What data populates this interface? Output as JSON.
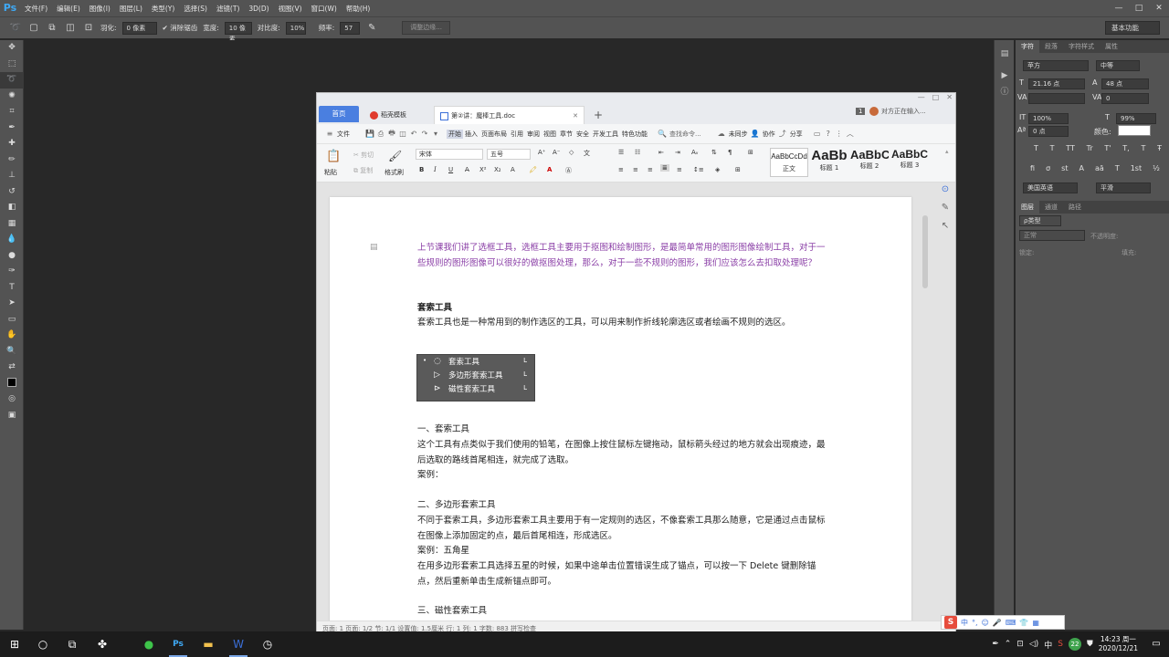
{
  "ps": {
    "logo": "Ps",
    "menu": [
      "文件(F)",
      "编辑(E)",
      "图像(I)",
      "图层(L)",
      "类型(Y)",
      "选择(S)",
      "滤镜(T)",
      "3D(D)",
      "视图(V)",
      "窗口(W)",
      "帮助(H)"
    ],
    "window_controls": [
      "—",
      "□",
      "✕"
    ],
    "options": {
      "feather_label": "羽化:",
      "feather_value": "0 像素",
      "antialias_label": "消除锯齿",
      "width_label": "宽度:",
      "width_value": "10 像素",
      "contrast_label": "对比度:",
      "contrast_value": "10%",
      "frequency_label": "频率:",
      "frequency_value": "57",
      "refine_edge": "调整边缘...",
      "workspace": "基本功能"
    },
    "panels": {
      "char_tabs": [
        "字符",
        "段落",
        "字符样式",
        "属性"
      ],
      "font_family": "苹方",
      "font_style": "中等",
      "font_size": "21.16 点",
      "leading": "48 点",
      "tracking": "0",
      "vscale": "100%",
      "hscale": "99%",
      "baseline": "0 点",
      "color_label": "颜色:",
      "type_buttons": [
        "T",
        "T",
        "TT",
        "Tr",
        "T'",
        "T,",
        "T",
        "Ŧ"
      ],
      "ot_buttons": [
        "fi",
        "σ",
        "st",
        "A",
        "aā",
        "T",
        "1st",
        "½"
      ],
      "language": "美国英语",
      "aa": "平滑",
      "layer_tabs": [
        "图层",
        "通道",
        "路径"
      ],
      "kind_label": "ρ类型",
      "blend_mode": "正常",
      "opacity_label": "不透明度:",
      "lock_label": "锁定:",
      "fill_label": "填充:"
    }
  },
  "wps": {
    "home_tab": "首页",
    "template_tab": "稻壳模板",
    "doc_tab": "第②讲：魔棒工具.doc",
    "add_tab": "+",
    "user_badge": "1",
    "user_status": "对方正在输入...",
    "menu": {
      "file": "文件",
      "items": [
        "开始",
        "插入",
        "页面布局",
        "引用",
        "审阅",
        "视图",
        "章节",
        "安全",
        "开发工具",
        "特色功能"
      ],
      "search": "查找命令...",
      "sync": "未同步",
      "collab": "协作",
      "share": "分享"
    },
    "ribbon": {
      "paste": "粘贴",
      "cut": "剪切",
      "copy": "复制",
      "format_painter": "格式刷",
      "font": "宋体",
      "size": "五号",
      "styles": [
        {
          "preview": "AaBbCcDd",
          "label": "正文"
        },
        {
          "preview": "AaBb",
          "label": "标题 1"
        },
        {
          "preview": "AaBbC",
          "label": "标题 2"
        },
        {
          "preview": "AaBbC",
          "label": "标题 3"
        }
      ]
    },
    "doc": {
      "intro": "上节课我们讲了选框工具，选框工具主要用于抠图和绘制图形，是最简单常用的图形图像绘制工具，对于一些规则的图形图像可以很好的做抠图处理，那么，对于一些不规则的图形，我们应该怎么去扣取处理呢？",
      "h1": "套索工具",
      "p1": "套索工具也是一种常用到的制作选区的工具，可以用来制作折线轮廓选区或者绘画不规则的选区。",
      "lasso_menu": [
        {
          "label": "套索工具",
          "key": "L"
        },
        {
          "label": "多边形套索工具",
          "key": "L"
        },
        {
          "label": "磁性套索工具",
          "key": "L"
        }
      ],
      "s1_title": "一、套索工具",
      "s1_body": "这个工具有点类似于我们使用的铅笔，在图像上按住鼠标左键拖动，鼠标箭头经过的地方就会出现痕迹，最后选取的路线首尾相连，就完成了选取。",
      "s1_example": "案例：",
      "s2_title": "二、多边形套索工具",
      "s2_body": "不同于套索工具，多边形套索工具主要用于有一定规则的选区，不像套索工具那么随意，它是通过点击鼠标在图像上添加固定的点，最后首尾相连，形成选区。",
      "s2_example": "案例：五角星",
      "s2_note": "在用多边形套索工具选择五星的时候，如果中途单击位置错误生成了锚点，可以按一下 Delete 键删除锚点，然后重新单击生成新锚点即可。",
      "s3_title": "三、磁性套索工具"
    },
    "status": "页面: 1    页面: 1/2    节: 1/1    设置值: 1.5厘米    行: 1    列: 1    字数: 883    拼写检查"
  },
  "ime": {
    "logo": "S",
    "mode": "中"
  },
  "taskbar": {
    "time": "14:23 周一",
    "date": "2020/12/21",
    "ime": "中",
    "badge": "22"
  }
}
